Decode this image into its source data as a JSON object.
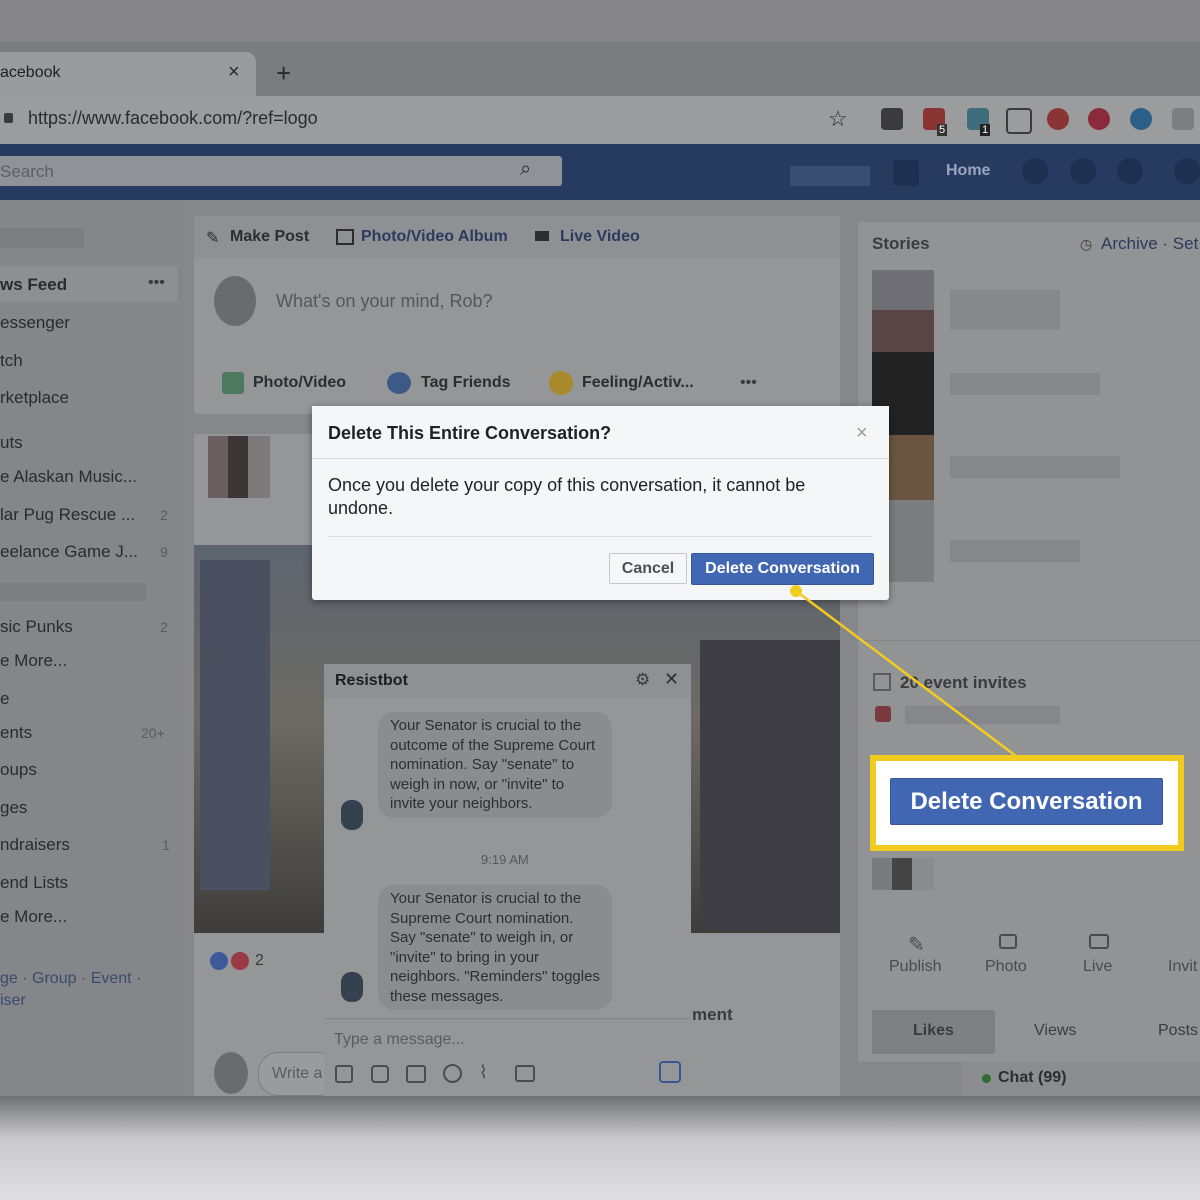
{
  "browser": {
    "tab_title": "acebook",
    "tab_close": "×",
    "new_tab": "+",
    "url": "https://www.facebook.com/?ref=logo",
    "star": "☆",
    "ext_badges": [
      "5",
      "1"
    ]
  },
  "header": {
    "search_placeholder": "Search",
    "home_label": "Home"
  },
  "left_nav": {
    "items": [
      {
        "label": "ws Feed",
        "count": "•••"
      },
      {
        "label": "essenger",
        "count": ""
      },
      {
        "label": "tch",
        "count": ""
      },
      {
        "label": "rketplace",
        "count": ""
      },
      {
        "label": "uts",
        "count": ""
      },
      {
        "label": "e Alaskan Music...",
        "count": ""
      },
      {
        "label": "lar Pug Rescue ...",
        "count": "2"
      },
      {
        "label": "eelance Game J...",
        "count": "9"
      },
      {
        "label": "sic Punks",
        "count": "2"
      },
      {
        "label": "e More...",
        "count": ""
      },
      {
        "label": "e",
        "count": ""
      },
      {
        "label": "ents",
        "count": "20+"
      },
      {
        "label": "oups",
        "count": ""
      },
      {
        "label": "ges",
        "count": ""
      },
      {
        "label": "ndraisers",
        "count": "1"
      },
      {
        "label": "end Lists",
        "count": ""
      },
      {
        "label": "e More...",
        "count": ""
      }
    ],
    "footer1": "ge · Group · Event ·",
    "footer2": "iser"
  },
  "composer": {
    "make_post": "Make Post",
    "photo_album": "Photo/Video Album",
    "live_video": "Live Video",
    "prompt": "What's on your mind, Rob?",
    "photo_video": "Photo/Video",
    "tag_friends": "Tag Friends",
    "feeling": "Feeling/Activ...",
    "more": "•••"
  },
  "post": {
    "reactions": "2",
    "comment_placeholder": "Write a",
    "comment_label": "ment"
  },
  "right_col": {
    "stories": "Stories",
    "archive": "Archive · Set",
    "event_invites": "20 event invites",
    "actions": [
      "Publish",
      "Photo",
      "Live",
      "Invit"
    ],
    "tabs": [
      "Likes",
      "Views",
      "Posts"
    ],
    "chat": "Chat (99)"
  },
  "dialog": {
    "title": "Delete This Entire Conversation?",
    "close": "×",
    "body": "Once you delete your copy of this conversation, it cannot be undone.",
    "cancel": "Cancel",
    "confirm": "Delete Conversation"
  },
  "chat_window": {
    "title": "Resistbot",
    "close": "✕",
    "message1": "Your Senator is crucial to the outcome of the Supreme Court nomination. Say \"senate\" to weigh in now, or \"invite\" to invite your neighbors.",
    "time": "9:19 AM",
    "message2": "Your Senator is crucial to the Supreme Court nomination. Say \"senate\" to weigh in, or \"invite\" to bring in your neighbors. \"Reminders\" toggles these messages.",
    "input_placeholder": "Type a message..."
  },
  "callout": {
    "label": "Delete Conversation",
    "highlight_color": "#f1cb1e"
  },
  "colors": {
    "fb_blue": "#4267b2",
    "header_dark": "#273a60"
  }
}
